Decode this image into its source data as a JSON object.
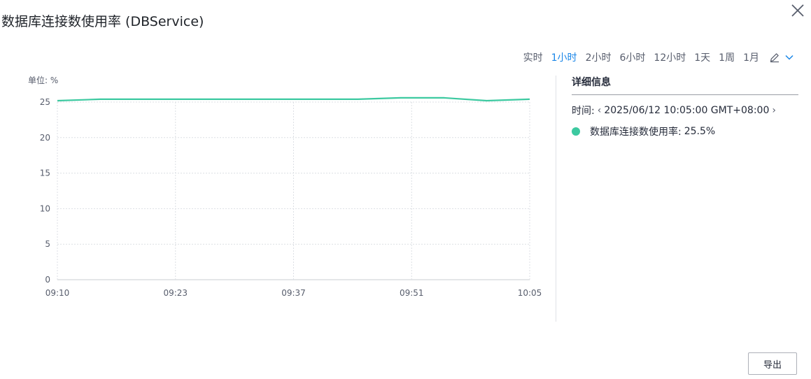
{
  "title": "数据库连接数使用率 (DBService)",
  "icons": {
    "close": "close-icon",
    "edit": "pencil-icon",
    "dropdown": "chevron-down-icon",
    "prev": "chevron-left-icon",
    "next": "chevron-right-icon"
  },
  "time_ranges": [
    {
      "label": "实时",
      "active": false
    },
    {
      "label": "1小时",
      "active": true
    },
    {
      "label": "2小时",
      "active": false
    },
    {
      "label": "6小时",
      "active": false
    },
    {
      "label": "12小时",
      "active": false
    },
    {
      "label": "1天",
      "active": false
    },
    {
      "label": "1周",
      "active": false
    },
    {
      "label": "1月",
      "active": false
    }
  ],
  "colors": {
    "accent": "#1a86e8",
    "series": "#3cc9a0"
  },
  "chart_data": {
    "type": "line",
    "unit_label": "单位: %",
    "x_tick_labels": [
      "09:10",
      "09:23",
      "09:37",
      "09:51",
      "10:05"
    ],
    "ylim": [
      0,
      25
    ],
    "y_ticks": [
      0,
      5,
      10,
      15,
      20,
      25
    ],
    "grid": true,
    "series": [
      {
        "name": "数据库连接数使用率",
        "x": [
          "09:10",
          "09:15",
          "09:20",
          "09:25",
          "09:30",
          "09:35",
          "09:40",
          "09:45",
          "09:50",
          "09:55",
          "10:00",
          "10:05"
        ],
        "values": [
          25.2,
          25.4,
          25.4,
          25.4,
          25.4,
          25.4,
          25.4,
          25.4,
          25.6,
          25.6,
          25.2,
          25.4
        ]
      }
    ]
  },
  "detail": {
    "title": "详细信息",
    "time_label": "时间:",
    "time_value": "2025/06/12 10:05:00 GMT+08:00",
    "metric_label": "数据库连接数使用率:",
    "metric_value": "25.5%"
  },
  "export_label": "导出"
}
